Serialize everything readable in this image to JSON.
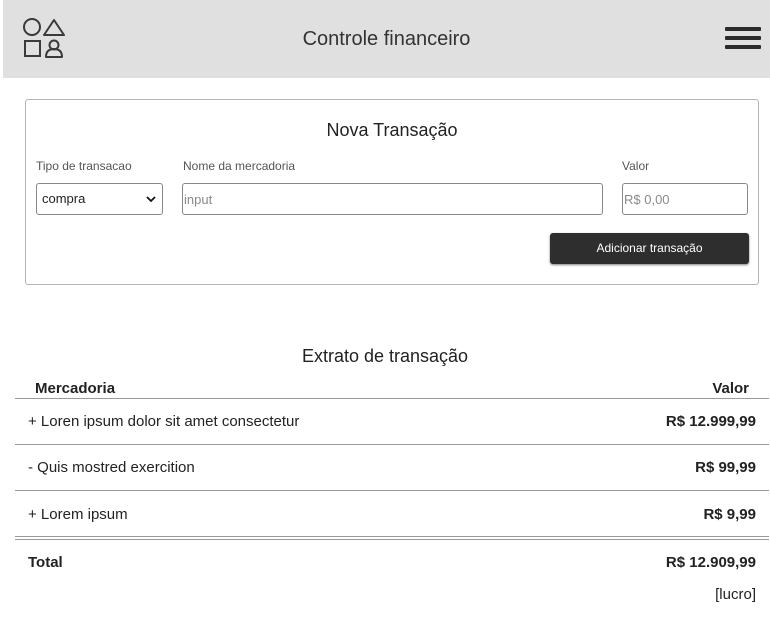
{
  "header": {
    "title": "Controle financeiro",
    "logo_icon": "shapes-logo-icon",
    "menu_icon": "hamburger-menu-icon"
  },
  "form": {
    "title": "Nova Transação",
    "type_label": "Tipo de transacao",
    "type_value": "compra",
    "name_label": "Nome da mercadoria",
    "name_placeholder": "input",
    "value_label": "Valor",
    "value_placeholder": "R$ 0,00",
    "submit_label": "Adicionar transação"
  },
  "statement": {
    "title": "Extrato de transação",
    "col_item": "Mercadoria",
    "col_value": "Valor",
    "rows": [
      {
        "desc": "+ Loren ipsum dolor sit amet consectetur",
        "value": "R$ 12.999,99"
      },
      {
        "desc": "- Quis mostred exercition",
        "value": "R$ 99,99"
      },
      {
        "desc": "+ Lorem ipsum",
        "value": "R$ 9,99"
      }
    ],
    "total_label": "Total",
    "total_value": "R$ 12.909,99",
    "total_status": "[lucro]"
  }
}
